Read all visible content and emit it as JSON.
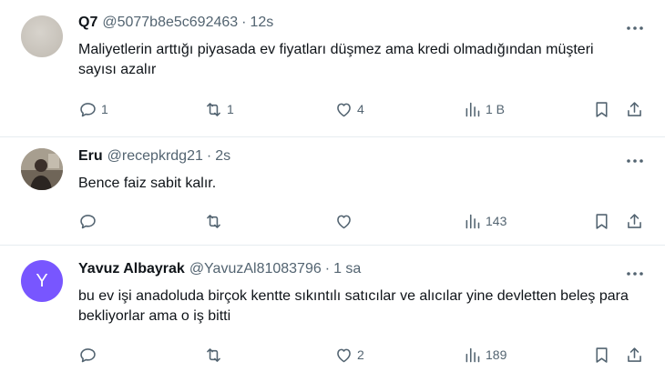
{
  "tweets": [
    {
      "name": "Q7",
      "handle": "@5077b8e5c692463",
      "separator": "·",
      "time": "12s",
      "text": "Maliyetlerin arttığı piyasada ev fiyatları düşmez ama kredi olmadığından müşteri sayısı azalır",
      "reply_count": "1",
      "retweet_count": "1",
      "like_count": "4",
      "view_count": "1 B"
    },
    {
      "name": "Eru",
      "handle": "@recepkrdg21",
      "separator": "·",
      "time": "2s",
      "text": "Bence faiz sabit kalır.",
      "reply_count": "",
      "retweet_count": "",
      "like_count": "",
      "view_count": "143"
    },
    {
      "name": "Yavuz Albayrak",
      "avatar_letter": "Y",
      "handle": "@YavuzAl81083796",
      "separator": "·",
      "time": "1 sa",
      "text": "bu ev işi anadoluda birçok kentte sıkıntılı satıcılar ve alıcılar yine devletten beleş para bekliyorlar ama o iş bitti",
      "reply_count": "",
      "retweet_count": "",
      "like_count": "2",
      "view_count": "189"
    }
  ],
  "icons": {
    "reply": "reply-icon",
    "retweet": "retweet-icon",
    "like": "heart-icon",
    "views": "views-icon",
    "bookmark": "bookmark-icon",
    "share": "share-icon",
    "more": "more-icon"
  },
  "colors": {
    "text": "#0f1419",
    "secondary": "#536471",
    "divider": "#e6ecf0",
    "avatar_purple": "#7856ff"
  }
}
